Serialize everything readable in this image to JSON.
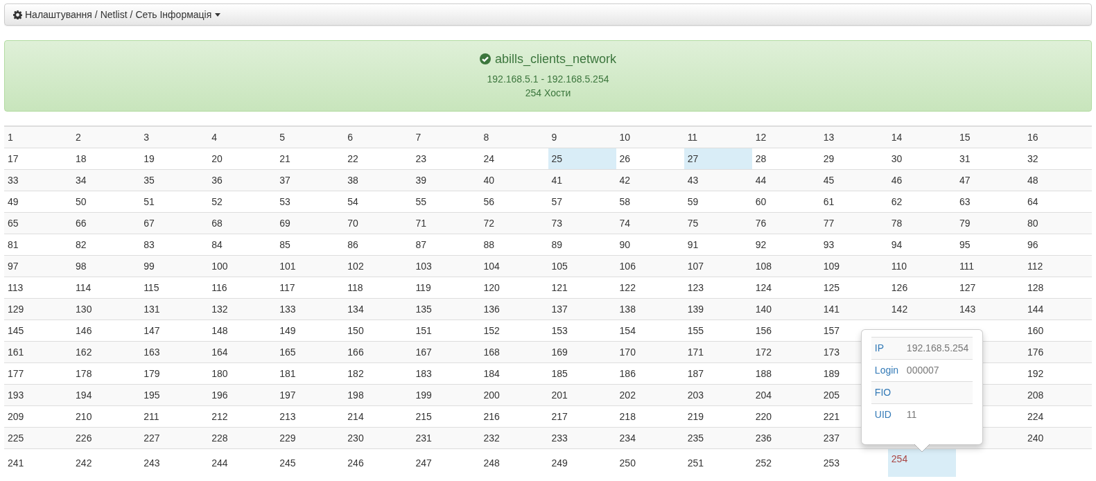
{
  "breadcrumb": {
    "items": [
      "Налаштування",
      "Netlist",
      "Сеть Інформація"
    ],
    "separator": "/"
  },
  "network": {
    "name": "abills_clients_network",
    "range": "192.168.5.1 - 192.168.5.254",
    "hosts": "254 Хости"
  },
  "table": {
    "rows": [
      [
        {
          "text": "1",
          "selected": false,
          "active": false
        },
        {
          "text": "2",
          "selected": false,
          "active": false
        },
        {
          "text": "3",
          "selected": false,
          "active": false
        },
        {
          "text": "4",
          "selected": false,
          "active": false
        },
        {
          "text": "5",
          "selected": false,
          "active": false
        },
        {
          "text": "6",
          "selected": false,
          "active": false
        },
        {
          "text": "7",
          "selected": false,
          "active": false
        },
        {
          "text": "8",
          "selected": false,
          "active": false
        },
        {
          "text": "9",
          "selected": false,
          "active": false
        },
        {
          "text": "10",
          "selected": false,
          "active": false
        },
        {
          "text": "11",
          "selected": false,
          "active": false
        },
        {
          "text": "12",
          "selected": false,
          "active": false
        },
        {
          "text": "13",
          "selected": false,
          "active": false
        },
        {
          "text": "14",
          "selected": false,
          "active": false
        },
        {
          "text": "15",
          "selected": false,
          "active": false
        },
        {
          "text": "16",
          "selected": false,
          "active": false
        }
      ],
      [
        {
          "text": "17",
          "selected": false,
          "active": false
        },
        {
          "text": "18",
          "selected": false,
          "active": false
        },
        {
          "text": "19",
          "selected": false,
          "active": false
        },
        {
          "text": "20",
          "selected": false,
          "active": false
        },
        {
          "text": "21",
          "selected": false,
          "active": false
        },
        {
          "text": "22",
          "selected": false,
          "active": false
        },
        {
          "text": "23",
          "selected": false,
          "active": false
        },
        {
          "text": "24",
          "selected": false,
          "active": false
        },
        {
          "text": "25",
          "selected": true,
          "active": false
        },
        {
          "text": "26",
          "selected": false,
          "active": false
        },
        {
          "text": "27",
          "selected": true,
          "active": false
        },
        {
          "text": "28",
          "selected": false,
          "active": false
        },
        {
          "text": "29",
          "selected": false,
          "active": false
        },
        {
          "text": "30",
          "selected": false,
          "active": false
        },
        {
          "text": "31",
          "selected": false,
          "active": false
        },
        {
          "text": "32",
          "selected": false,
          "active": false
        }
      ],
      [
        {
          "text": "33",
          "selected": false,
          "active": false
        },
        {
          "text": "34",
          "selected": false,
          "active": false
        },
        {
          "text": "35",
          "selected": false,
          "active": false
        },
        {
          "text": "36",
          "selected": false,
          "active": false
        },
        {
          "text": "37",
          "selected": false,
          "active": false
        },
        {
          "text": "38",
          "selected": false,
          "active": false
        },
        {
          "text": "39",
          "selected": false,
          "active": false
        },
        {
          "text": "40",
          "selected": false,
          "active": false
        },
        {
          "text": "41",
          "selected": false,
          "active": false
        },
        {
          "text": "42",
          "selected": false,
          "active": false
        },
        {
          "text": "43",
          "selected": false,
          "active": false
        },
        {
          "text": "44",
          "selected": false,
          "active": false
        },
        {
          "text": "45",
          "selected": false,
          "active": false
        },
        {
          "text": "46",
          "selected": false,
          "active": false
        },
        {
          "text": "47",
          "selected": false,
          "active": false
        },
        {
          "text": "48",
          "selected": false,
          "active": false
        }
      ],
      [
        {
          "text": "49",
          "selected": false,
          "active": false
        },
        {
          "text": "50",
          "selected": false,
          "active": false
        },
        {
          "text": "51",
          "selected": false,
          "active": false
        },
        {
          "text": "52",
          "selected": false,
          "active": false
        },
        {
          "text": "53",
          "selected": false,
          "active": false
        },
        {
          "text": "54",
          "selected": false,
          "active": false
        },
        {
          "text": "55",
          "selected": false,
          "active": false
        },
        {
          "text": "56",
          "selected": false,
          "active": false
        },
        {
          "text": "57",
          "selected": false,
          "active": false
        },
        {
          "text": "58",
          "selected": false,
          "active": false
        },
        {
          "text": "59",
          "selected": false,
          "active": false
        },
        {
          "text": "60",
          "selected": false,
          "active": false
        },
        {
          "text": "61",
          "selected": false,
          "active": false
        },
        {
          "text": "62",
          "selected": false,
          "active": false
        },
        {
          "text": "63",
          "selected": false,
          "active": false
        },
        {
          "text": "64",
          "selected": false,
          "active": false
        }
      ],
      [
        {
          "text": "65",
          "selected": false,
          "active": false
        },
        {
          "text": "66",
          "selected": false,
          "active": false
        },
        {
          "text": "67",
          "selected": false,
          "active": false
        },
        {
          "text": "68",
          "selected": false,
          "active": false
        },
        {
          "text": "69",
          "selected": false,
          "active": false
        },
        {
          "text": "70",
          "selected": false,
          "active": false
        },
        {
          "text": "71",
          "selected": false,
          "active": false
        },
        {
          "text": "72",
          "selected": false,
          "active": false
        },
        {
          "text": "73",
          "selected": false,
          "active": false
        },
        {
          "text": "74",
          "selected": false,
          "active": false
        },
        {
          "text": "75",
          "selected": false,
          "active": false
        },
        {
          "text": "76",
          "selected": false,
          "active": false
        },
        {
          "text": "77",
          "selected": false,
          "active": false
        },
        {
          "text": "78",
          "selected": false,
          "active": false
        },
        {
          "text": "79",
          "selected": false,
          "active": false
        },
        {
          "text": "80",
          "selected": false,
          "active": false
        }
      ],
      [
        {
          "text": "81",
          "selected": false,
          "active": false
        },
        {
          "text": "82",
          "selected": false,
          "active": false
        },
        {
          "text": "83",
          "selected": false,
          "active": false
        },
        {
          "text": "84",
          "selected": false,
          "active": false
        },
        {
          "text": "85",
          "selected": false,
          "active": false
        },
        {
          "text": "86",
          "selected": false,
          "active": false
        },
        {
          "text": "87",
          "selected": false,
          "active": false
        },
        {
          "text": "88",
          "selected": false,
          "active": false
        },
        {
          "text": "89",
          "selected": false,
          "active": false
        },
        {
          "text": "90",
          "selected": false,
          "active": false
        },
        {
          "text": "91",
          "selected": false,
          "active": false
        },
        {
          "text": "92",
          "selected": false,
          "active": false
        },
        {
          "text": "93",
          "selected": false,
          "active": false
        },
        {
          "text": "94",
          "selected": false,
          "active": false
        },
        {
          "text": "95",
          "selected": false,
          "active": false
        },
        {
          "text": "96",
          "selected": false,
          "active": false
        }
      ],
      [
        {
          "text": "97",
          "selected": false,
          "active": false
        },
        {
          "text": "98",
          "selected": false,
          "active": false
        },
        {
          "text": "99",
          "selected": false,
          "active": false
        },
        {
          "text": "100",
          "selected": false,
          "active": false
        },
        {
          "text": "101",
          "selected": false,
          "active": false
        },
        {
          "text": "102",
          "selected": false,
          "active": false
        },
        {
          "text": "103",
          "selected": false,
          "active": false
        },
        {
          "text": "104",
          "selected": false,
          "active": false
        },
        {
          "text": "105",
          "selected": false,
          "active": false
        },
        {
          "text": "106",
          "selected": false,
          "active": false
        },
        {
          "text": "107",
          "selected": false,
          "active": false
        },
        {
          "text": "108",
          "selected": false,
          "active": false
        },
        {
          "text": "109",
          "selected": false,
          "active": false
        },
        {
          "text": "110",
          "selected": false,
          "active": false
        },
        {
          "text": "111",
          "selected": false,
          "active": false
        },
        {
          "text": "112",
          "selected": false,
          "active": false
        }
      ],
      [
        {
          "text": "113",
          "selected": false,
          "active": false
        },
        {
          "text": "114",
          "selected": false,
          "active": false
        },
        {
          "text": "115",
          "selected": false,
          "active": false
        },
        {
          "text": "116",
          "selected": false,
          "active": false
        },
        {
          "text": "117",
          "selected": false,
          "active": false
        },
        {
          "text": "118",
          "selected": false,
          "active": false
        },
        {
          "text": "119",
          "selected": false,
          "active": false
        },
        {
          "text": "120",
          "selected": false,
          "active": false
        },
        {
          "text": "121",
          "selected": false,
          "active": false
        },
        {
          "text": "122",
          "selected": false,
          "active": false
        },
        {
          "text": "123",
          "selected": false,
          "active": false
        },
        {
          "text": "124",
          "selected": false,
          "active": false
        },
        {
          "text": "125",
          "selected": false,
          "active": false
        },
        {
          "text": "126",
          "selected": false,
          "active": false
        },
        {
          "text": "127",
          "selected": false,
          "active": false
        },
        {
          "text": "128",
          "selected": false,
          "active": false
        }
      ],
      [
        {
          "text": "129",
          "selected": false,
          "active": false
        },
        {
          "text": "130",
          "selected": false,
          "active": false
        },
        {
          "text": "131",
          "selected": false,
          "active": false
        },
        {
          "text": "132",
          "selected": false,
          "active": false
        },
        {
          "text": "133",
          "selected": false,
          "active": false
        },
        {
          "text": "134",
          "selected": false,
          "active": false
        },
        {
          "text": "135",
          "selected": false,
          "active": false
        },
        {
          "text": "136",
          "selected": false,
          "active": false
        },
        {
          "text": "137",
          "selected": false,
          "active": false
        },
        {
          "text": "138",
          "selected": false,
          "active": false
        },
        {
          "text": "139",
          "selected": false,
          "active": false
        },
        {
          "text": "140",
          "selected": false,
          "active": false
        },
        {
          "text": "141",
          "selected": false,
          "active": false
        },
        {
          "text": "142",
          "selected": false,
          "active": false
        },
        {
          "text": "143",
          "selected": false,
          "active": false
        },
        {
          "text": "144",
          "selected": false,
          "active": false
        }
      ],
      [
        {
          "text": "145",
          "selected": false,
          "active": false
        },
        {
          "text": "146",
          "selected": false,
          "active": false
        },
        {
          "text": "147",
          "selected": false,
          "active": false
        },
        {
          "text": "148",
          "selected": false,
          "active": false
        },
        {
          "text": "149",
          "selected": false,
          "active": false
        },
        {
          "text": "150",
          "selected": false,
          "active": false
        },
        {
          "text": "151",
          "selected": false,
          "active": false
        },
        {
          "text": "152",
          "selected": false,
          "active": false
        },
        {
          "text": "153",
          "selected": false,
          "active": false
        },
        {
          "text": "154",
          "selected": false,
          "active": false
        },
        {
          "text": "155",
          "selected": false,
          "active": false
        },
        {
          "text": "156",
          "selected": false,
          "active": false
        },
        {
          "text": "157",
          "selected": false,
          "active": false
        },
        null,
        null,
        {
          "text": "160",
          "selected": false,
          "active": false
        }
      ],
      [
        {
          "text": "161",
          "selected": false,
          "active": false
        },
        {
          "text": "162",
          "selected": false,
          "active": false
        },
        {
          "text": "163",
          "selected": false,
          "active": false
        },
        {
          "text": "164",
          "selected": false,
          "active": false
        },
        {
          "text": "165",
          "selected": false,
          "active": false
        },
        {
          "text": "166",
          "selected": false,
          "active": false
        },
        {
          "text": "167",
          "selected": false,
          "active": false
        },
        {
          "text": "168",
          "selected": false,
          "active": false
        },
        {
          "text": "169",
          "selected": false,
          "active": false
        },
        {
          "text": "170",
          "selected": false,
          "active": false
        },
        {
          "text": "171",
          "selected": false,
          "active": false
        },
        {
          "text": "172",
          "selected": false,
          "active": false
        },
        {
          "text": "173",
          "selected": false,
          "active": false
        },
        null,
        null,
        {
          "text": "176",
          "selected": false,
          "active": false
        }
      ],
      [
        {
          "text": "177",
          "selected": false,
          "active": false
        },
        {
          "text": "178",
          "selected": false,
          "active": false
        },
        {
          "text": "179",
          "selected": false,
          "active": false
        },
        {
          "text": "180",
          "selected": false,
          "active": false
        },
        {
          "text": "181",
          "selected": false,
          "active": false
        },
        {
          "text": "182",
          "selected": false,
          "active": false
        },
        {
          "text": "183",
          "selected": false,
          "active": false
        },
        {
          "text": "184",
          "selected": false,
          "active": false
        },
        {
          "text": "185",
          "selected": false,
          "active": false
        },
        {
          "text": "186",
          "selected": false,
          "active": false
        },
        {
          "text": "187",
          "selected": false,
          "active": false
        },
        {
          "text": "188",
          "selected": false,
          "active": false
        },
        {
          "text": "189",
          "selected": false,
          "active": false
        },
        null,
        null,
        {
          "text": "192",
          "selected": false,
          "active": false
        }
      ],
      [
        {
          "text": "193",
          "selected": false,
          "active": false
        },
        {
          "text": "194",
          "selected": false,
          "active": false
        },
        {
          "text": "195",
          "selected": false,
          "active": false
        },
        {
          "text": "196",
          "selected": false,
          "active": false
        },
        {
          "text": "197",
          "selected": false,
          "active": false
        },
        {
          "text": "198",
          "selected": false,
          "active": false
        },
        {
          "text": "199",
          "selected": false,
          "active": false
        },
        {
          "text": "200",
          "selected": false,
          "active": false
        },
        {
          "text": "201",
          "selected": false,
          "active": false
        },
        {
          "text": "202",
          "selected": false,
          "active": false
        },
        {
          "text": "203",
          "selected": false,
          "active": false
        },
        {
          "text": "204",
          "selected": false,
          "active": false
        },
        {
          "text": "205",
          "selected": false,
          "active": false
        },
        null,
        null,
        {
          "text": "208",
          "selected": false,
          "active": false
        }
      ],
      [
        {
          "text": "209",
          "selected": false,
          "active": false
        },
        {
          "text": "210",
          "selected": false,
          "active": false
        },
        {
          "text": "211",
          "selected": false,
          "active": false
        },
        {
          "text": "212",
          "selected": false,
          "active": false
        },
        {
          "text": "213",
          "selected": false,
          "active": false
        },
        {
          "text": "214",
          "selected": false,
          "active": false
        },
        {
          "text": "215",
          "selected": false,
          "active": false
        },
        {
          "text": "216",
          "selected": false,
          "active": false
        },
        {
          "text": "217",
          "selected": false,
          "active": false
        },
        {
          "text": "218",
          "selected": false,
          "active": false
        },
        {
          "text": "219",
          "selected": false,
          "active": false
        },
        {
          "text": "220",
          "selected": false,
          "active": false
        },
        {
          "text": "221",
          "selected": false,
          "active": false
        },
        null,
        null,
        {
          "text": "224",
          "selected": false,
          "active": false
        }
      ],
      [
        {
          "text": "225",
          "selected": false,
          "active": false
        },
        {
          "text": "226",
          "selected": false,
          "active": false
        },
        {
          "text": "227",
          "selected": false,
          "active": false
        },
        {
          "text": "228",
          "selected": false,
          "active": false
        },
        {
          "text": "229",
          "selected": false,
          "active": false
        },
        {
          "text": "230",
          "selected": false,
          "active": false
        },
        {
          "text": "231",
          "selected": false,
          "active": false
        },
        {
          "text": "232",
          "selected": false,
          "active": false
        },
        {
          "text": "233",
          "selected": false,
          "active": false
        },
        {
          "text": "234",
          "selected": false,
          "active": false
        },
        {
          "text": "235",
          "selected": false,
          "active": false
        },
        {
          "text": "236",
          "selected": false,
          "active": false
        },
        {
          "text": "237",
          "selected": false,
          "active": false
        },
        null,
        null,
        {
          "text": "240",
          "selected": false,
          "active": false
        }
      ],
      [
        {
          "text": "241",
          "selected": false,
          "active": false
        },
        {
          "text": "242",
          "selected": false,
          "active": false
        },
        {
          "text": "243",
          "selected": false,
          "active": false
        },
        {
          "text": "244",
          "selected": false,
          "active": false
        },
        {
          "text": "245",
          "selected": false,
          "active": false
        },
        {
          "text": "246",
          "selected": false,
          "active": false
        },
        {
          "text": "247",
          "selected": false,
          "active": false
        },
        {
          "text": "248",
          "selected": false,
          "active": false
        },
        {
          "text": "249",
          "selected": false,
          "active": false
        },
        {
          "text": "250",
          "selected": false,
          "active": false
        },
        {
          "text": "251",
          "selected": false,
          "active": false
        },
        {
          "text": "252",
          "selected": false,
          "active": false
        },
        {
          "text": "253",
          "selected": false,
          "active": false
        },
        {
          "text": "254",
          "selected": true,
          "active": true
        }
      ]
    ]
  },
  "popover": {
    "rows": [
      {
        "label": "IP",
        "value": "192.168.5.254"
      },
      {
        "label": "Login",
        "value": "000007"
      },
      {
        "label": "FIO"
      },
      {
        "label": "UID",
        "value": "11"
      }
    ]
  }
}
